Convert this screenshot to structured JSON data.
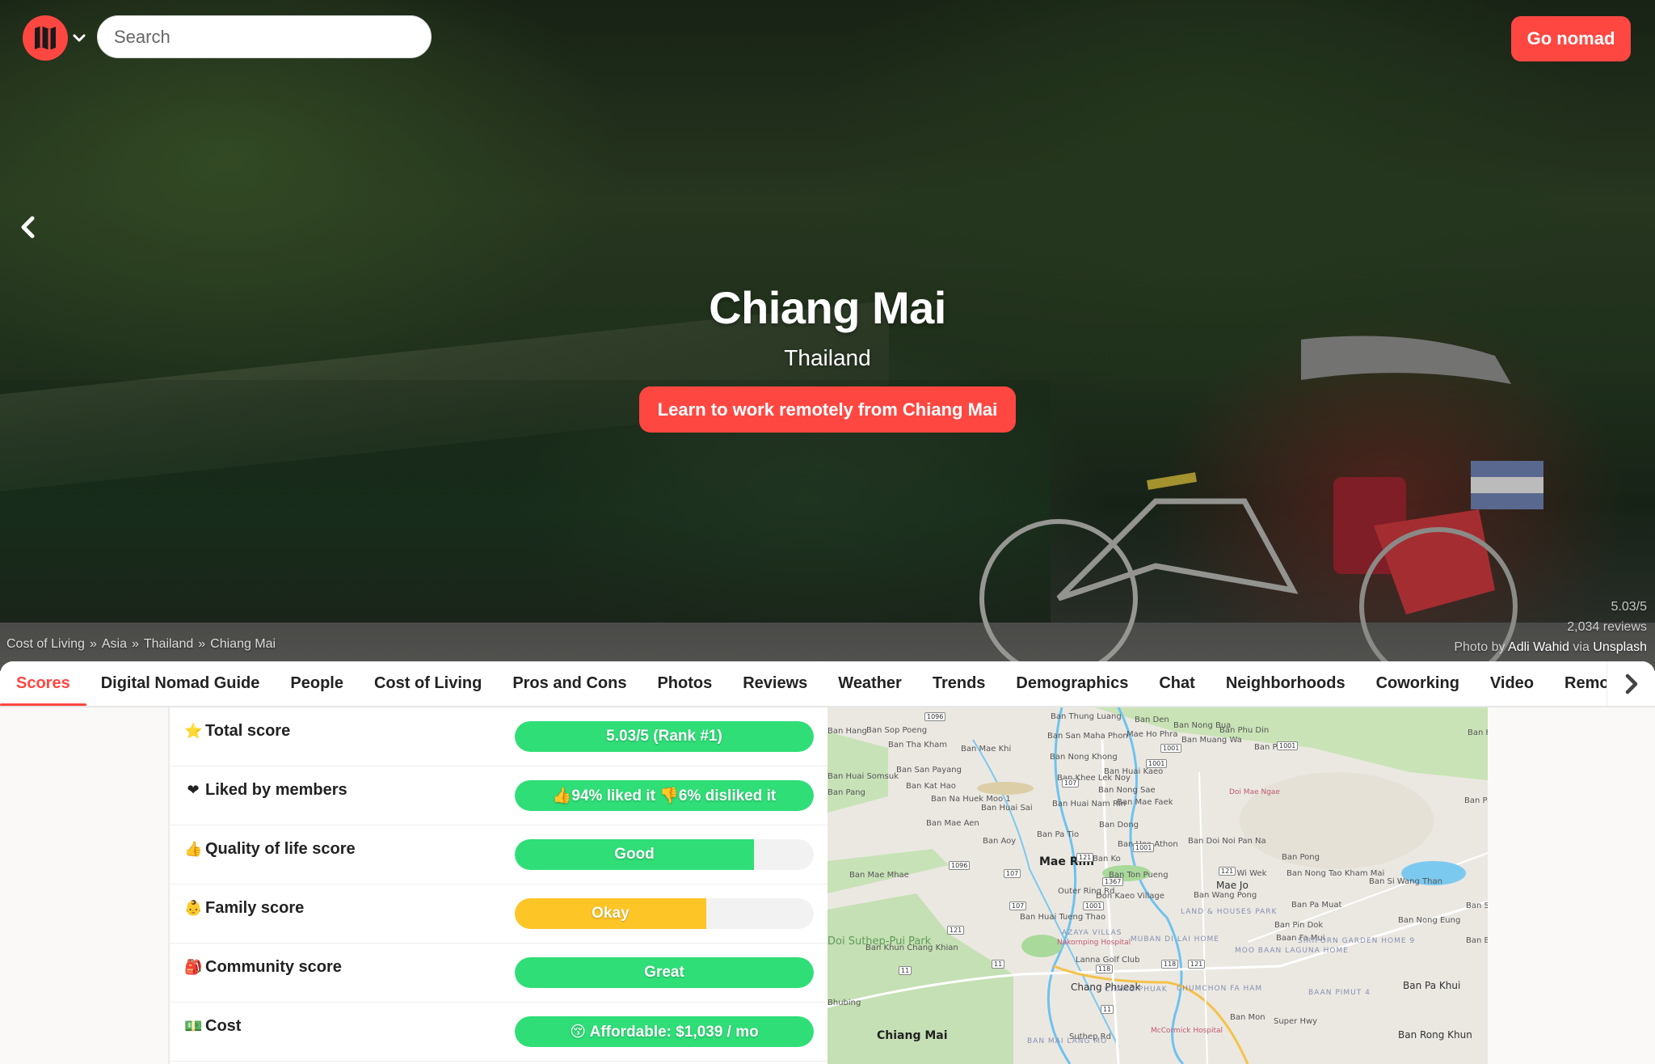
{
  "header": {
    "logo_alt": "Nomad List",
    "search": {
      "placeholder": "Search",
      "value": ""
    },
    "go_nomad_label": "Go nomad"
  },
  "hero": {
    "city": "Chiang Mai",
    "country": "Thailand",
    "cta_label": "Learn to work remotely from Chiang Mai",
    "breadcrumb": [
      "Cost of Living",
      "Asia",
      "Thailand",
      "Chiang Mai"
    ],
    "breadcrumb_separator": "»",
    "rating": "5.03/5",
    "reviews": "2,034 reviews",
    "credit": {
      "prefix": "Photo by",
      "author": "Adli Wahid",
      "via": "via",
      "source": "Unsplash"
    }
  },
  "tabs": [
    {
      "label": "Scores",
      "active": true
    },
    {
      "label": "Digital Nomad Guide"
    },
    {
      "label": "People"
    },
    {
      "label": "Cost of Living"
    },
    {
      "label": "Pros and Cons"
    },
    {
      "label": "Photos"
    },
    {
      "label": "Reviews"
    },
    {
      "label": "Weather"
    },
    {
      "label": "Trends"
    },
    {
      "label": "Demographics"
    },
    {
      "label": "Chat"
    },
    {
      "label": "Neighborhoods"
    },
    {
      "label": "Coworking"
    },
    {
      "label": "Video"
    },
    {
      "label": "Remote"
    }
  ],
  "colors": {
    "brand": "#ff4742",
    "green": "#2fde77",
    "yellow": "#fdc526",
    "track": "#f2f2f2"
  },
  "scores": [
    {
      "emoji": "⭐",
      "icon": "star-icon",
      "label": "Total score",
      "value": "5.03/5 (Rank #1)",
      "fill": 1.0,
      "color": "green"
    },
    {
      "emoji": "❤",
      "icon": "heart-icon",
      "label": "Liked by members",
      "value": "👍94% liked it 👎6% disliked it",
      "fill": 1.0,
      "color": "green"
    },
    {
      "emoji": "👍",
      "icon": "thumbs-up-icon",
      "label": "Quality of life score",
      "value": "Good",
      "fill": 0.8,
      "color": "green"
    },
    {
      "emoji": "👶",
      "icon": "baby-icon",
      "label": "Family score",
      "value": "Okay",
      "fill": 0.64,
      "color": "yellow"
    },
    {
      "emoji": "🎒",
      "icon": "backpack-icon",
      "label": "Community score",
      "value": "Great",
      "fill": 1.0,
      "color": "green"
    },
    {
      "emoji": "💵",
      "icon": "money-icon",
      "label": "Cost",
      "value": "😚 Affordable: $1,039 / mo",
      "fill": 1.0,
      "color": "green"
    }
  ],
  "map": {
    "labels": [
      {
        "t": "Ban Sop Poeng",
        "c": ""
      },
      {
        "t": "Ban Tha Kham",
        "c": ""
      },
      {
        "t": "Ban San Payang",
        "c": ""
      },
      {
        "t": "Ban Kat Hao",
        "c": ""
      },
      {
        "t": "Ban Na Huek Moo 1",
        "c": ""
      },
      {
        "t": "Ban Mae Aen",
        "c": ""
      },
      {
        "t": "Ban Huai Sai",
        "c": ""
      },
      {
        "t": "Ban Aoy",
        "c": ""
      },
      {
        "t": "Ban Mae Khi",
        "c": ""
      },
      {
        "t": "Ban Nong Khong",
        "c": ""
      },
      {
        "t": "Ban Khee Lek Noy",
        "c": ""
      },
      {
        "t": "Ban Huai Nam Rin",
        "c": ""
      },
      {
        "t": "Ban Pa Tio",
        "c": ""
      },
      {
        "t": "Mae Rim",
        "c": "big"
      },
      {
        "t": "Ban Ko",
        "c": ""
      },
      {
        "t": "Ban Ton Pueng",
        "c": ""
      },
      {
        "t": "Ban Huai Kaeo",
        "c": ""
      },
      {
        "t": "Ban Nong Sae",
        "c": ""
      },
      {
        "t": "Ban Mae Faek",
        "c": ""
      },
      {
        "t": "Ban Dong",
        "c": ""
      },
      {
        "t": "Ban Uea Athon",
        "c": ""
      },
      {
        "t": "Ban Den",
        "c": ""
      },
      {
        "t": "Mae Ho Phra",
        "c": ""
      },
      {
        "t": "Ban Nong Bua",
        "c": ""
      },
      {
        "t": "Ban Phu Din",
        "c": ""
      },
      {
        "t": "Ban Muang Wa",
        "c": ""
      },
      {
        "t": "Ban Pamai",
        "c": ""
      },
      {
        "t": "Doi Mae Ngae",
        "c": "poi"
      },
      {
        "t": "Ban Doi Noi Pan Na",
        "c": ""
      },
      {
        "t": "Ban Pong",
        "c": ""
      },
      {
        "t": "Ban Nong Tao Kham Mai",
        "c": ""
      },
      {
        "t": "Ban Wi Wek",
        "c": ""
      },
      {
        "t": "Mae Jo",
        "c": "mid"
      },
      {
        "t": "Ban Si Wang Than",
        "c": ""
      },
      {
        "t": "Ban Pa Sak Ngam",
        "c": ""
      },
      {
        "t": "Ban Wang Pong",
        "c": ""
      },
      {
        "t": "Don Kaeo Village",
        "c": ""
      },
      {
        "t": "Ban Pa Muat",
        "c": ""
      },
      {
        "t": "Ban Pin Dok",
        "c": ""
      },
      {
        "t": "Baan Fa Mui",
        "c": ""
      },
      {
        "t": "Ban Nong Eung",
        "c": ""
      },
      {
        "t": "Ban Bo Hin",
        "c": ""
      },
      {
        "t": "LAND & HOUSES PARK",
        "c": "area"
      },
      {
        "t": "MUBAN DI LAI HOME",
        "c": "area"
      },
      {
        "t": "SIRIPORN GARDEN HOME 9",
        "c": "area"
      },
      {
        "t": "MOO BAAN LAGUNA HOME",
        "c": "area"
      },
      {
        "t": "Ban Huai Tueng Thao",
        "c": ""
      },
      {
        "t": "Nakornping Hospital",
        "c": "poi"
      },
      {
        "t": "Lanna Golf Club",
        "c": ""
      },
      {
        "t": "Chang Phueak",
        "c": "mid"
      },
      {
        "t": "CHANG PHUAK",
        "c": "area"
      },
      {
        "t": "CHUMCHON FA HAM",
        "c": "area"
      },
      {
        "t": "BAAN PIMUT 4",
        "c": "area"
      },
      {
        "t": "Ban Pa Khui",
        "c": "mid"
      },
      {
        "t": "Ban Mon",
        "c": ""
      },
      {
        "t": "McCormick Hospital",
        "c": "poi"
      },
      {
        "t": "Chiang Mai",
        "c": "big"
      },
      {
        "t": "Suthep Rd",
        "c": ""
      },
      {
        "t": "BAN MAI LANG MO",
        "c": "area"
      },
      {
        "t": "Ban Rong Khun",
        "c": "mid"
      },
      {
        "t": "Ban Mae Mhae",
        "c": ""
      },
      {
        "t": "Ban Khun Chang Khian",
        "c": ""
      },
      {
        "t": "Doi Suthep-Pui Park",
        "c": "park"
      },
      {
        "t": "Bhubing",
        "c": ""
      },
      {
        "t": "AZAYA VILLAS",
        "c": "area"
      },
      {
        "t": "Outer Ring Rd",
        "c": ""
      },
      {
        "t": "Super Hwy",
        "c": ""
      },
      {
        "t": "Ban Hang",
        "c": ""
      },
      {
        "t": "Ban Pang",
        "c": ""
      },
      {
        "t": "Ban Huai Somsuk",
        "c": ""
      },
      {
        "t": "Ban Thung Luang",
        "c": ""
      },
      {
        "t": "Ban San Maha Phon",
        "c": ""
      },
      {
        "t": "Ban San Ton Pao",
        "c": ""
      },
      {
        "t": "Ban Ha",
        "c": ""
      }
    ],
    "shields": [
      "107",
      "107",
      "107",
      "1096",
      "1096",
      "1001",
      "1001",
      "1001",
      "1001",
      "121",
      "121",
      "121",
      "1367",
      "11",
      "11",
      "11",
      "118",
      "118",
      "1001",
      "121"
    ]
  }
}
